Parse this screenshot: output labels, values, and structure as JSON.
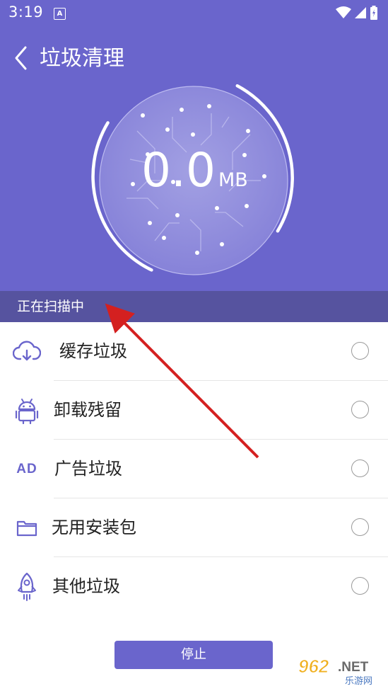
{
  "status_bar": {
    "time": "3:19",
    "notification_icon": "A"
  },
  "header": {
    "title": "垃圾清理"
  },
  "scan": {
    "size_value": "0.0",
    "size_unit": "MB",
    "status_text": "正在扫描中"
  },
  "items": [
    {
      "label": "缓存垃圾",
      "icon": "cloud-download-icon"
    },
    {
      "label": "卸载残留",
      "icon": "android-icon"
    },
    {
      "label": "广告垃圾",
      "icon": "ad-icon",
      "icon_text": "AD"
    },
    {
      "label": "无用安装包",
      "icon": "folder-icon"
    },
    {
      "label": "其他垃圾",
      "icon": "rocket-icon"
    }
  ],
  "actions": {
    "stop_label": "停止"
  },
  "watermark": {
    "main": "962.NET",
    "sub": "乐游网"
  },
  "colors": {
    "primary": "#6a65cc",
    "scan_bar": "#56539f",
    "annotation_arrow": "#d42020"
  }
}
